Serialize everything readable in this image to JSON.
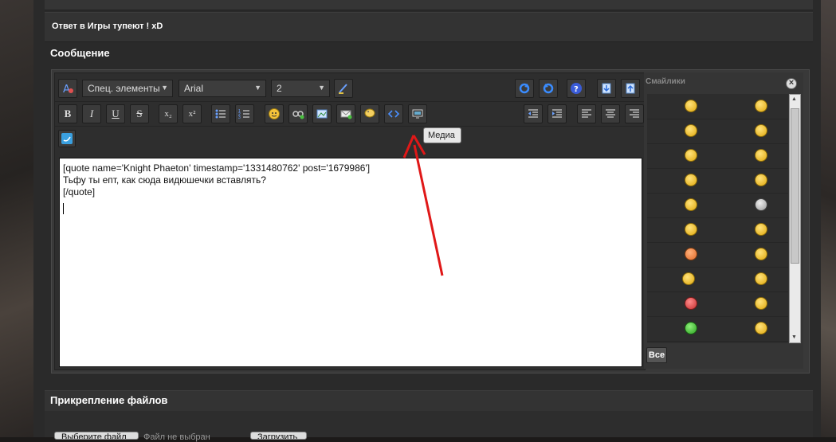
{
  "thread": {
    "reply_title": "Ответ в Игры тупеют ! xD"
  },
  "editor": {
    "section_title": "Сообщение",
    "special_elements": "Спец. элементы",
    "font": "Arial",
    "size": "2",
    "content_lines": [
      "[quote name='Knight Phaeton' timestamp='1331480762' post='1679986']",
      "Тьфу ты епт, как сюда видюшечки вставлять?",
      "[/quote]"
    ],
    "tooltip": "Медиа",
    "buttons": {
      "bold": "B",
      "italic": "I",
      "underline": "U",
      "strike": "S",
      "sub": "x₂",
      "sup": "x²"
    }
  },
  "smilies": {
    "title": "Смайлики",
    "all_button": "Все"
  },
  "attachments": {
    "section_title": "Прикрепление файлов",
    "choose_button": "Выберите файл",
    "no_file": "Файл не выбран",
    "upload_button": "Загрузить"
  }
}
